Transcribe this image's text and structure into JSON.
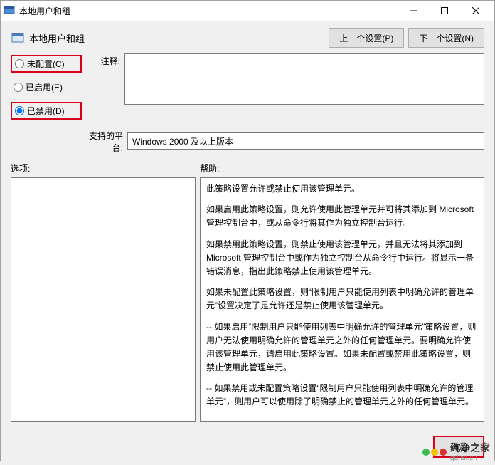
{
  "window": {
    "title": "本地用户和组"
  },
  "header": {
    "title": "本地用户和组",
    "prev": "上一个设置(P)",
    "next": "下一个设置(N)"
  },
  "radios": {
    "not_configured": "未配置(C)",
    "enabled": "已启用(E)",
    "disabled": "已禁用(D)"
  },
  "labels": {
    "comment": "注释:",
    "platform": "支持的平台:",
    "options": "选项:",
    "help": "帮助:"
  },
  "platform_value": "Windows 2000 及以上版本",
  "help_paragraphs": [
    "此策略设置允许或禁止使用该管理单元。",
    "如果启用此策略设置，则允许使用此管理单元并可将其添加到 Microsoft 管理控制台中，或从命令行将其作为独立控制台运行。",
    "如果禁用此策略设置，则禁止使用该管理单元，并且无法将其添加到 Microsoft 管理控制台中或作为独立控制台从命令行中运行。将显示一条错误消息，指出此策略禁止使用该管理单元。",
    "如果未配置此策略设置，则“限制用户只能使用列表中明确允许的管理单元”设置决定了是允许还是禁止使用该管理单元。",
    "--  如果启用“限制用户只能使用列表中明确允许的管理单元”策略设置，则用户无法使用明确允许的管理单元之外的任何管理单元。要明确允许使用该管理单元，请启用此策略设置。如果未配置或禁用此策略设置，则禁止使用此管理单元。",
    "--  如果禁用或未配置策略设置“限制用户只能使用列表中明确允许的管理单元”，则用户可以使用除了明确禁止的管理单元之外的任何管理单元。"
  ],
  "footer": {
    "ok": "确定"
  },
  "watermark": {
    "text": "纯净之家",
    "url": "gdhst.cn"
  }
}
